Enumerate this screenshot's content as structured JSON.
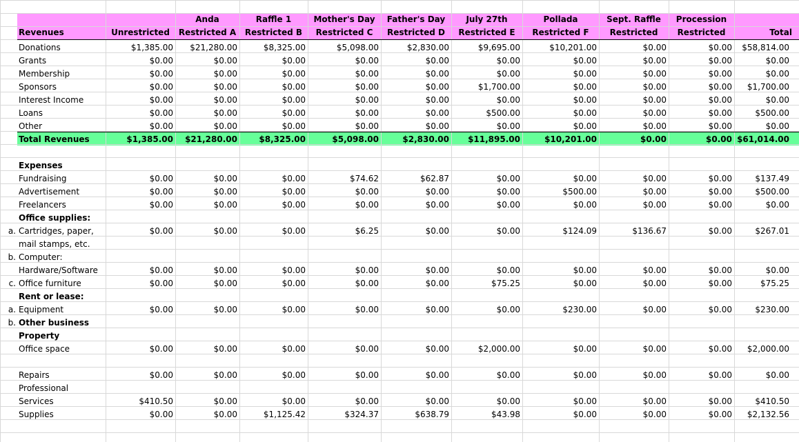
{
  "colors": {
    "header_band": "#ff99ff",
    "total_band": "#66ff99",
    "grid": "#d8d8d8"
  },
  "header": {
    "line1": [
      "",
      "",
      "Anda",
      "Raffle 1",
      "Mother's Day",
      "Father's Day",
      "July 27th",
      "Pollada",
      "Sept. Raffle",
      "Procession",
      ""
    ],
    "line2": [
      "Revenues",
      "Unrestricted",
      "Restricted A",
      "Restricted B",
      "Restricted C",
      "Restricted D",
      "Restricted E",
      "Restricted F",
      "Restricted",
      "Restricted",
      "Total"
    ]
  },
  "rows": [
    {
      "label": "Donations",
      "values": [
        "$1,385.00",
        "$21,280.00",
        "$8,325.00",
        "$5,098.00",
        "$2,830.00",
        "$9,695.00",
        "$10,201.00",
        "$0.00",
        "$0.00",
        "$58,814.00"
      ]
    },
    {
      "label": "Grants",
      "values": [
        "$0.00",
        "$0.00",
        "$0.00",
        "$0.00",
        "$0.00",
        "$0.00",
        "$0.00",
        "$0.00",
        "$0.00",
        "$0.00"
      ]
    },
    {
      "label": "Membership",
      "values": [
        "$0.00",
        "$0.00",
        "$0.00",
        "$0.00",
        "$0.00",
        "$0.00",
        "$0.00",
        "$0.00",
        "$0.00",
        "$0.00"
      ]
    },
    {
      "label": "Sponsors",
      "values": [
        "$0.00",
        "$0.00",
        "$0.00",
        "$0.00",
        "$0.00",
        "$1,700.00",
        "$0.00",
        "$0.00",
        "$0.00",
        "$1,700.00"
      ]
    },
    {
      "label": "Interest Income",
      "values": [
        "$0.00",
        "$0.00",
        "$0.00",
        "$0.00",
        "$0.00",
        "$0.00",
        "$0.00",
        "$0.00",
        "$0.00",
        "$0.00"
      ]
    },
    {
      "label": "Loans",
      "values": [
        "$0.00",
        "$0.00",
        "$0.00",
        "$0.00",
        "$0.00",
        "$500.00",
        "$0.00",
        "$0.00",
        "$0.00",
        "$500.00"
      ]
    },
    {
      "label": "Other",
      "values": [
        "$0.00",
        "$0.00",
        "$0.00",
        "$0.00",
        "$0.00",
        "$0.00",
        "$0.00",
        "$0.00",
        "$0.00",
        "$0.00"
      ]
    },
    {
      "label": "Total Revenues",
      "bold": true,
      "total": true,
      "values": [
        "$1,385.00",
        "$21,280.00",
        "$8,325.00",
        "$5,098.00",
        "$2,830.00",
        "$11,895.00",
        "$10,201.00",
        "$0.00",
        "$0.00",
        "$61,014.00"
      ]
    },
    {
      "label": ""
    },
    {
      "label": "Expenses",
      "bold": true
    },
    {
      "label": "Fundraising",
      "values": [
        "$0.00",
        "$0.00",
        "$0.00",
        "$74.62",
        "$62.87",
        "$0.00",
        "$0.00",
        "$0.00",
        "$0.00",
        "$137.49"
      ]
    },
    {
      "label": "Advertisement",
      "values": [
        "$0.00",
        "$0.00",
        "$0.00",
        "$0.00",
        "$0.00",
        "$0.00",
        "$500.00",
        "$0.00",
        "$0.00",
        "$500.00"
      ]
    },
    {
      "label": "Freelancers",
      "values": [
        "$0.00",
        "$0.00",
        "$0.00",
        "$0.00",
        "$0.00",
        "$0.00",
        "$0.00",
        "$0.00",
        "$0.00",
        "$0.00"
      ]
    },
    {
      "label": "Office supplies:",
      "bold": true
    },
    {
      "marker": "a.",
      "label": "Cartridges, paper,",
      "values": [
        "$0.00",
        "$0.00",
        "$0.00",
        "$6.25",
        "$0.00",
        "$0.00",
        "$124.09",
        "$136.67",
        "$0.00",
        "$267.01"
      ]
    },
    {
      "label": "mail stamps, etc."
    },
    {
      "marker": "b.",
      "label": "Computer:"
    },
    {
      "label": "Hardware/Software",
      "values": [
        "$0.00",
        "$0.00",
        "$0.00",
        "$0.00",
        "$0.00",
        "$0.00",
        "$0.00",
        "$0.00",
        "$0.00",
        "$0.00"
      ]
    },
    {
      "marker": "c.",
      "label": "Office furniture",
      "values": [
        "$0.00",
        "$0.00",
        "$0.00",
        "$0.00",
        "$0.00",
        "$75.25",
        "$0.00",
        "$0.00",
        "$0.00",
        "$75.25"
      ]
    },
    {
      "label": "Rent or lease:",
      "bold": true
    },
    {
      "marker": "a.",
      "label": "Equipment",
      "values": [
        "$0.00",
        "$0.00",
        "$0.00",
        "$0.00",
        "$0.00",
        "$0.00",
        "$230.00",
        "$0.00",
        "$0.00",
        "$230.00"
      ]
    },
    {
      "marker": "b.",
      "label": "Other business",
      "bold": true
    },
    {
      "label": "Property",
      "bold": true
    },
    {
      "label": "Office space",
      "values": [
        "$0.00",
        "$0.00",
        "$0.00",
        "$0.00",
        "$0.00",
        "$2,000.00",
        "$0.00",
        "$0.00",
        "$0.00",
        "$2,000.00"
      ]
    },
    {
      "label": ""
    },
    {
      "label": "Repairs",
      "values": [
        "$0.00",
        "$0.00",
        "$0.00",
        "$0.00",
        "$0.00",
        "$0.00",
        "$0.00",
        "$0.00",
        "$0.00",
        "$0.00"
      ]
    },
    {
      "label": "Professional"
    },
    {
      "label": "Services",
      "values": [
        "$410.50",
        "$0.00",
        "$0.00",
        "$0.00",
        "$0.00",
        "$0.00",
        "$0.00",
        "$0.00",
        "$0.00",
        "$410.50"
      ]
    },
    {
      "label": "Supplies",
      "values": [
        "$0.00",
        "$0.00",
        "$1,125.42",
        "$324.37",
        "$638.79",
        "$43.98",
        "$0.00",
        "$0.00",
        "$0.00",
        "$2,132.56"
      ]
    }
  ]
}
